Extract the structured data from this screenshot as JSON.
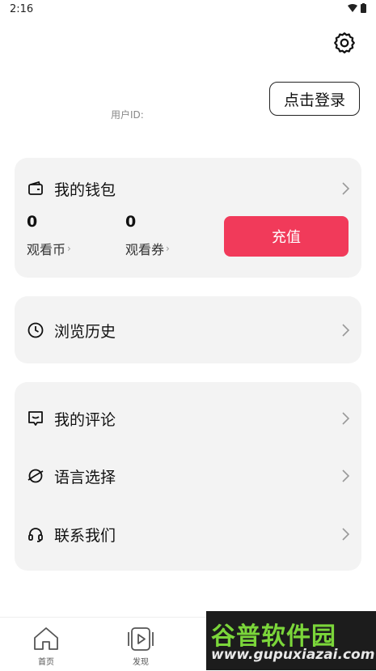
{
  "status_bar": {
    "time": "2:16"
  },
  "header": {
    "login_label": "点击登录",
    "user_id_label": "用户ID:"
  },
  "wallet": {
    "title": "我的钱包",
    "coins_value": "0",
    "coins_label": "观看币",
    "vouchers_value": "0",
    "vouchers_label": "观看券",
    "recharge_label": "充值"
  },
  "history": {
    "label": "浏览历史"
  },
  "menu": {
    "items": [
      {
        "label": "我的评论",
        "icon": "comment-icon"
      },
      {
        "label": "语言选择",
        "icon": "planet-icon"
      },
      {
        "label": "联系我们",
        "icon": "headset-icon"
      }
    ]
  },
  "tabbar": {
    "tabs": [
      {
        "label": "首页",
        "icon": "home-icon"
      },
      {
        "label": "发现",
        "icon": "video-icon"
      }
    ]
  },
  "watermark": {
    "brand": "谷普软件园",
    "url": "www.gupuxiazai.com"
  },
  "colors": {
    "accent": "#f13a5a",
    "card_bg": "#f3f3f3"
  }
}
